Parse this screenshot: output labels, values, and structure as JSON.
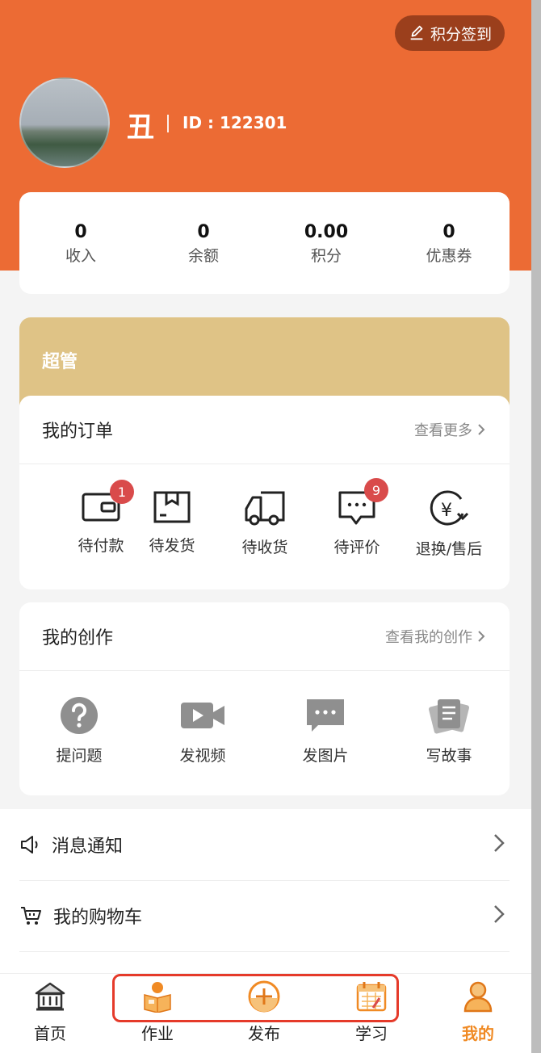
{
  "header": {
    "checkin_label": "积分签到",
    "username": "丑",
    "id_label": "ID : 122301"
  },
  "stats": [
    {
      "value": "0",
      "label": "收入"
    },
    {
      "value": "0",
      "label": "余额"
    },
    {
      "value": "0.00",
      "label": "积分"
    },
    {
      "value": "0",
      "label": "优惠券"
    }
  ],
  "role_card": {
    "title": "超管"
  },
  "orders": {
    "title": "我的订单",
    "more": "查看更多",
    "items": [
      {
        "label": "待付款",
        "icon": "wallet-icon",
        "badge": "1"
      },
      {
        "label": "待发货",
        "icon": "box-icon",
        "badge": ""
      },
      {
        "label": "待收货",
        "icon": "truck-icon",
        "badge": ""
      },
      {
        "label": "待评价",
        "icon": "comment-icon",
        "badge": "9"
      },
      {
        "label": "退换/售后",
        "icon": "refund-icon",
        "badge": ""
      }
    ]
  },
  "creation": {
    "title": "我的创作",
    "more": "查看我的创作",
    "items": [
      {
        "label": "提问题",
        "icon": "question-icon"
      },
      {
        "label": "发视频",
        "icon": "video-icon"
      },
      {
        "label": "发图片",
        "icon": "image-message-icon"
      },
      {
        "label": "写故事",
        "icon": "story-icon"
      }
    ]
  },
  "menu": [
    {
      "label": "消息通知",
      "icon": "speaker-icon"
    },
    {
      "label": "我的购物车",
      "icon": "cart-icon"
    }
  ],
  "tabbar": [
    {
      "label": "首页",
      "icon": "home-icon",
      "active": false
    },
    {
      "label": "作业",
      "icon": "homework-icon",
      "active": false
    },
    {
      "label": "发布",
      "icon": "publish-icon",
      "active": false
    },
    {
      "label": "学习",
      "icon": "calendar-icon",
      "active": false
    },
    {
      "label": "我的",
      "icon": "profile-icon",
      "active": true
    }
  ],
  "colors": {
    "header_bg": "#ec6b34",
    "gold_card": "#dfc386",
    "badge": "#d94b4b",
    "active_tab": "#f08a24",
    "highlight_box": "#e53a2a"
  }
}
